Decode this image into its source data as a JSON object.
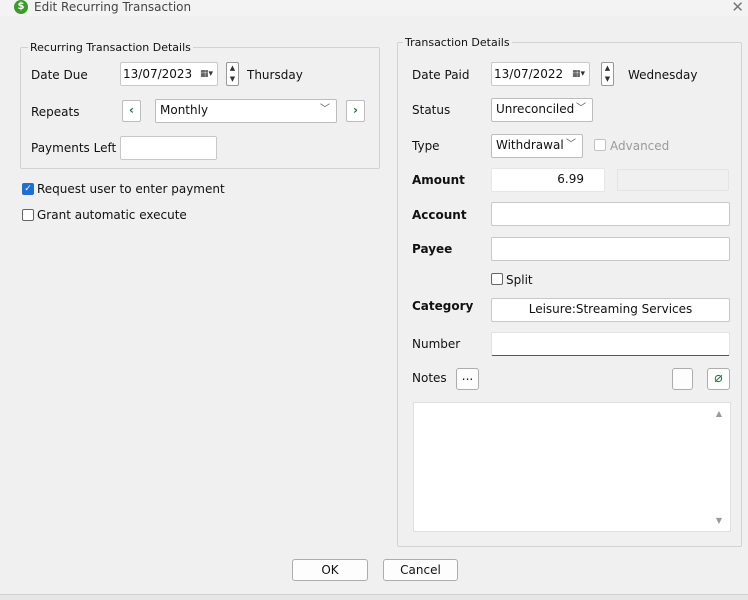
{
  "window": {
    "title": "Edit Recurring Transaction",
    "close_glyph": "✕",
    "app_icon_glyph": "$"
  },
  "recurring": {
    "legend": "Recurring Transaction Details",
    "date_due_label": "Date Due",
    "date_due_value": "13/07/2023",
    "date_due_day": "Thursday",
    "repeats_label": "Repeats",
    "repeats_value": "Monthly",
    "payments_left_label": "Payments Left",
    "payments_left_value": ""
  },
  "options": {
    "request_user_label": "Request user to enter payment",
    "request_user_checked": true,
    "grant_auto_label": "Grant automatic execute",
    "grant_auto_checked": false
  },
  "transaction": {
    "legend": "Transaction Details",
    "date_paid_label": "Date Paid",
    "date_paid_value": "13/07/2022",
    "date_paid_day": "Wednesday",
    "status_label": "Status",
    "status_value": "Unreconciled",
    "type_label": "Type",
    "type_value": "Withdrawal",
    "advanced_label": "Advanced",
    "amount_label": "Amount",
    "amount_value": "6.99",
    "account_label": "Account",
    "account_value": "",
    "payee_label": "Payee",
    "payee_value": "",
    "split_label": "Split",
    "category_label": "Category",
    "category_value": "Leisure:Streaming Services",
    "number_label": "Number",
    "number_value": "",
    "notes_label": "Notes",
    "notes_button": "...",
    "notes_value": ""
  },
  "footer": {
    "ok_label": "OK",
    "cancel_label": "Cancel"
  },
  "colors": {
    "accent": "#1e6fd0",
    "nav_arrow": "#1f6e3a",
    "app_icon": "#3a9a2a"
  }
}
